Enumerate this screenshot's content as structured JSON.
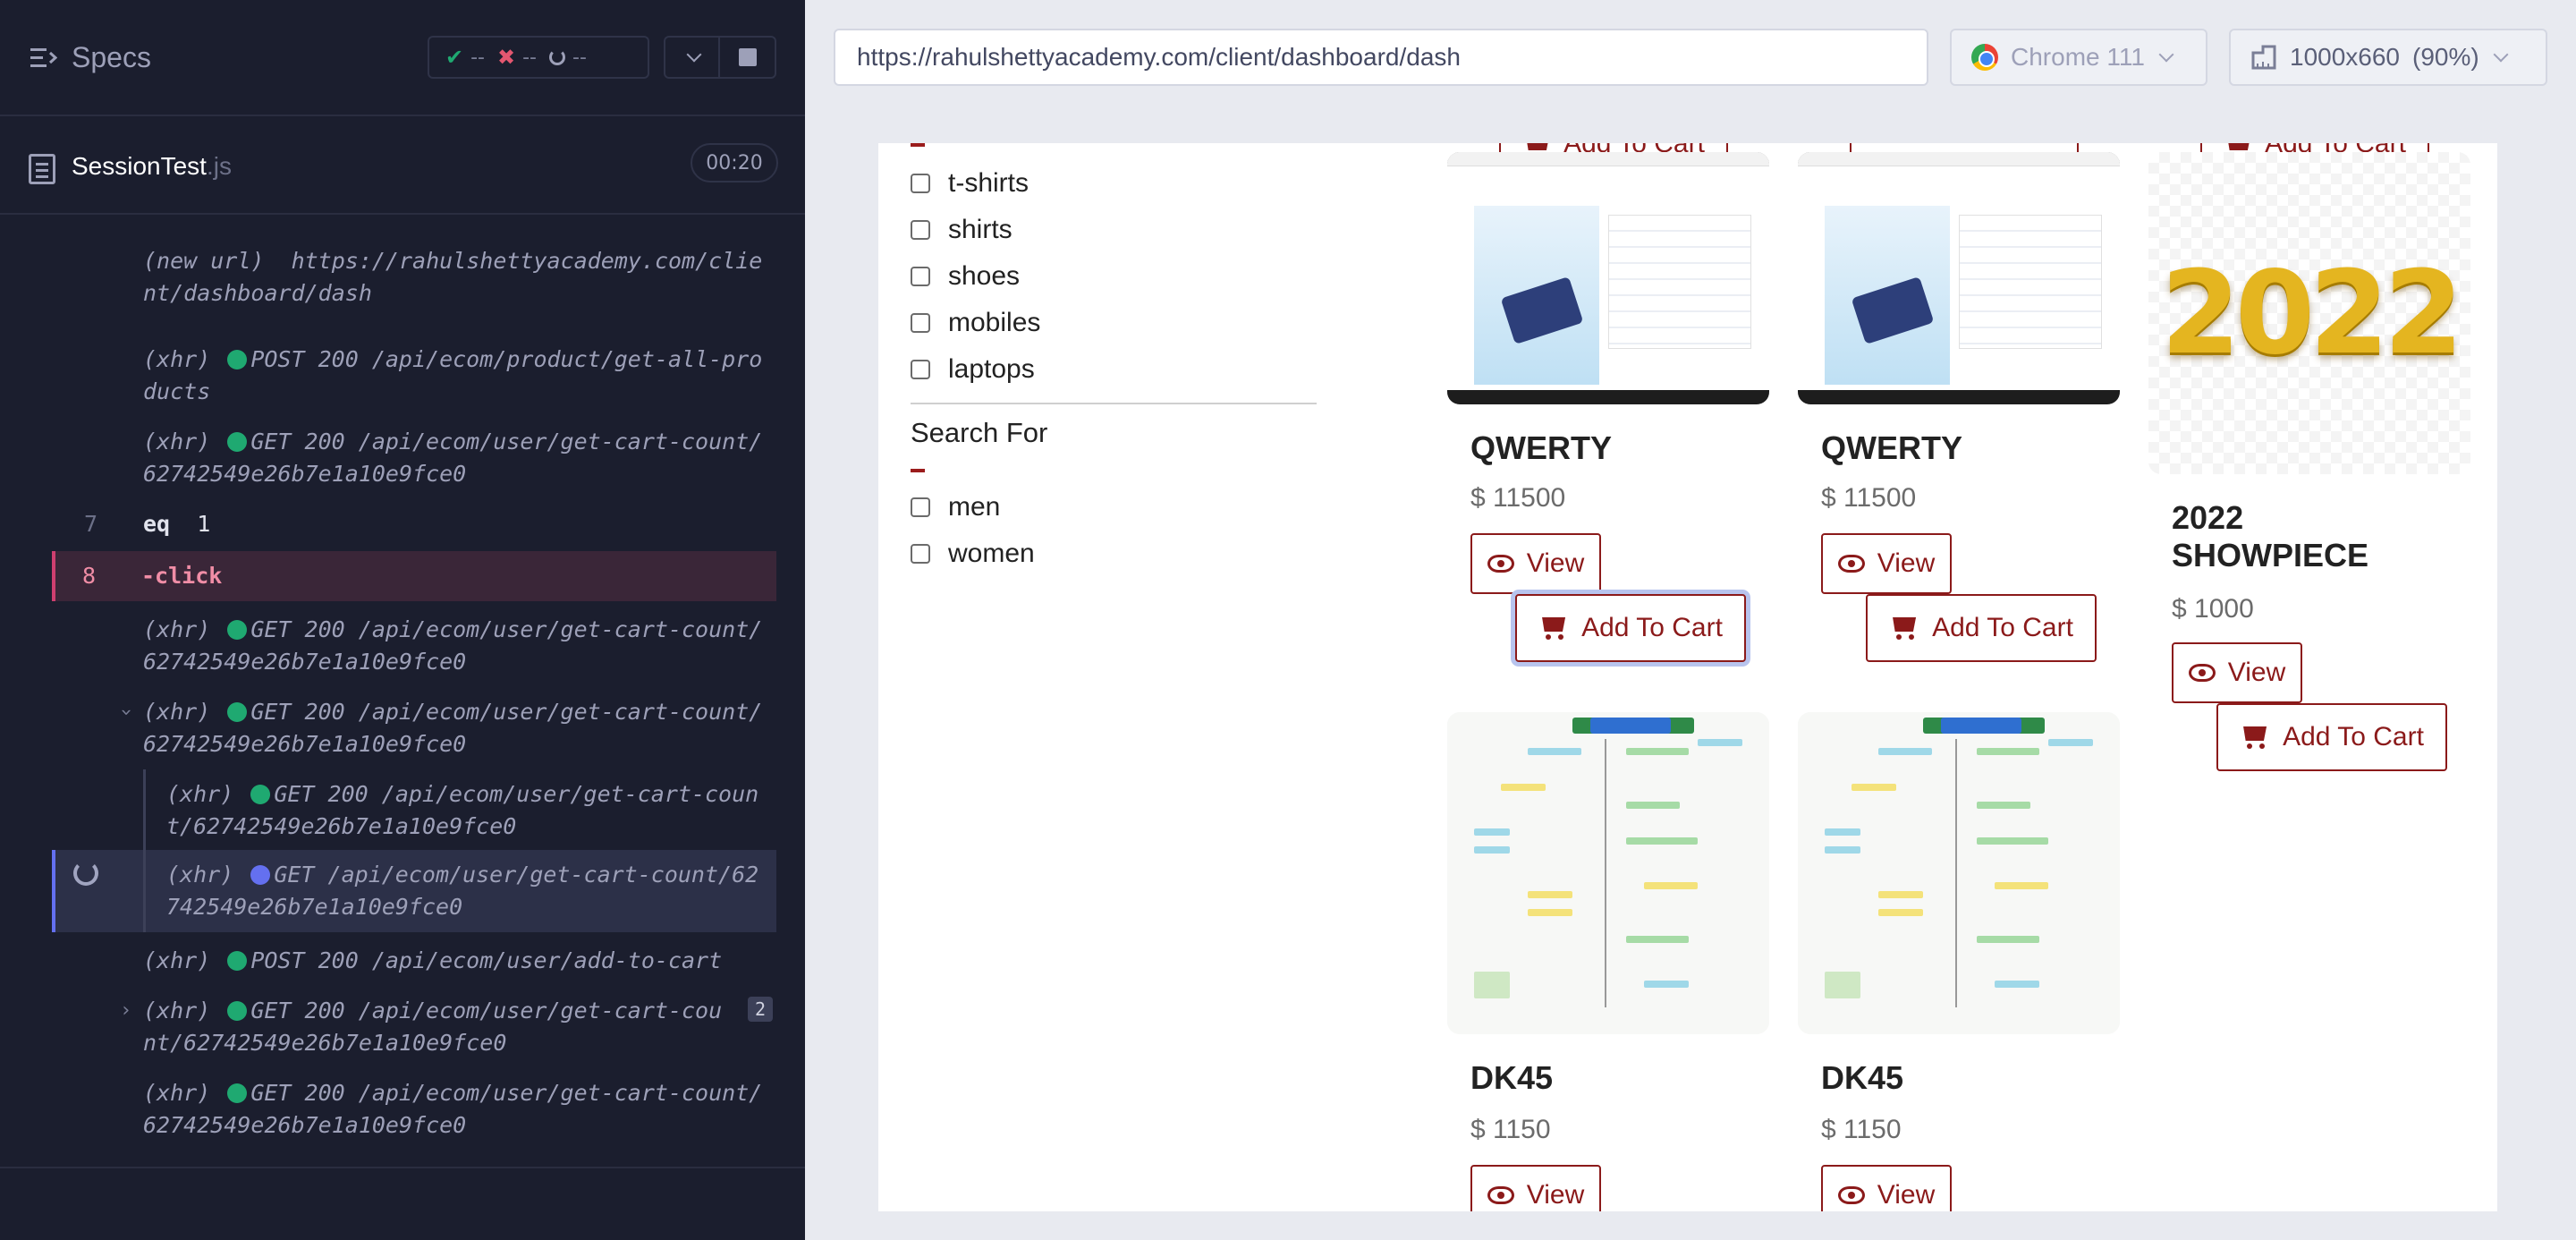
{
  "runner": {
    "specs_label": "Specs",
    "stats": {
      "passed": "--",
      "failed": "--",
      "pending": "--"
    },
    "spec_file": {
      "name": "SessionTest",
      "ext": ".js",
      "duration": "00:20"
    },
    "commands": [
      {
        "id": "c1",
        "text": "(new url)  https://rahulshettyacademy.com/client/dashboard/dash"
      },
      {
        "id": "c2",
        "prefix": "(xhr)",
        "method": "POST",
        "status": "200",
        "path": "/api/ecom/product/get-all-products"
      },
      {
        "id": "c3",
        "prefix": "(xhr)",
        "method": "GET",
        "status": "200",
        "path": "/api/ecom/user/get-cart-count/62742549e26b7e1a10e9fce0"
      },
      {
        "id": "c4",
        "num": "7",
        "name": "eq",
        "arg": "1"
      },
      {
        "id": "c5",
        "num": "8",
        "name": "-click"
      },
      {
        "id": "c6",
        "prefix": "(xhr)",
        "method": "GET",
        "status": "200",
        "path": "/api/ecom/user/get-cart-count/62742549e26b7e1a10e9fce0"
      },
      {
        "id": "c7",
        "prefix": "(xhr)",
        "method": "GET",
        "status": "200",
        "path": "/api/ecom/user/get-cart-count/62742549e26b7e1a10e9fce0"
      },
      {
        "id": "c8",
        "prefix": "(xhr)",
        "method": "GET",
        "status": "200",
        "path": "/api/ecom/user/get-cart-count/62742549e26b7e1a10e9fce0"
      },
      {
        "id": "c9",
        "prefix": "(xhr)",
        "method": "GET",
        "path": "/api/ecom/user/get-cart-count/62742549e26b7e1a10e9fce0"
      },
      {
        "id": "c10",
        "prefix": "(xhr)",
        "method": "POST",
        "status": "200",
        "path": "/api/ecom/user/add-to-cart"
      },
      {
        "id": "c11",
        "prefix": "(xhr)",
        "method": "GET",
        "status": "200",
        "path": "/api/ecom/user/get-cart-count/62742549e26b7e1a10e9fce0",
        "count": "2"
      },
      {
        "id": "c12",
        "prefix": "(xhr)",
        "method": "GET",
        "status": "200",
        "path": "/api/ecom/user/get-cart-count/62742549e26b7e1a10e9fce0"
      }
    ]
  },
  "preview": {
    "url": "https://rahulshettyacademy.com/client/dashboard/dash",
    "browser": "Chrome 111",
    "viewport": "1000x660",
    "zoom": "(90%)"
  },
  "shop": {
    "categories": [
      "t-shirts",
      "shirts",
      "shoes",
      "mobiles",
      "laptops"
    ],
    "search_for_label": "Search For",
    "search_for_options": [
      "men",
      "women"
    ],
    "view_label": "View",
    "add_to_cart_label": "Add To Cart",
    "products": [
      {
        "title": "QWERTY",
        "price": "$ 11500"
      },
      {
        "title": "QWERTY",
        "price": "$ 11500"
      },
      {
        "title": "2022 SHOWPIECE",
        "price": "$ 1000",
        "image_text": "2022"
      },
      {
        "title": "DK45",
        "price": "$ 1150"
      },
      {
        "title": "DK45",
        "price": "$ 1150"
      }
    ]
  },
  "colors": {
    "runner_bg": "#1b1e2e",
    "pass": "#1fa971",
    "fail": "#e45770",
    "active_click": "#ce3f6f",
    "pending": "#6470f0",
    "brand_red": "#8b1a1a"
  }
}
